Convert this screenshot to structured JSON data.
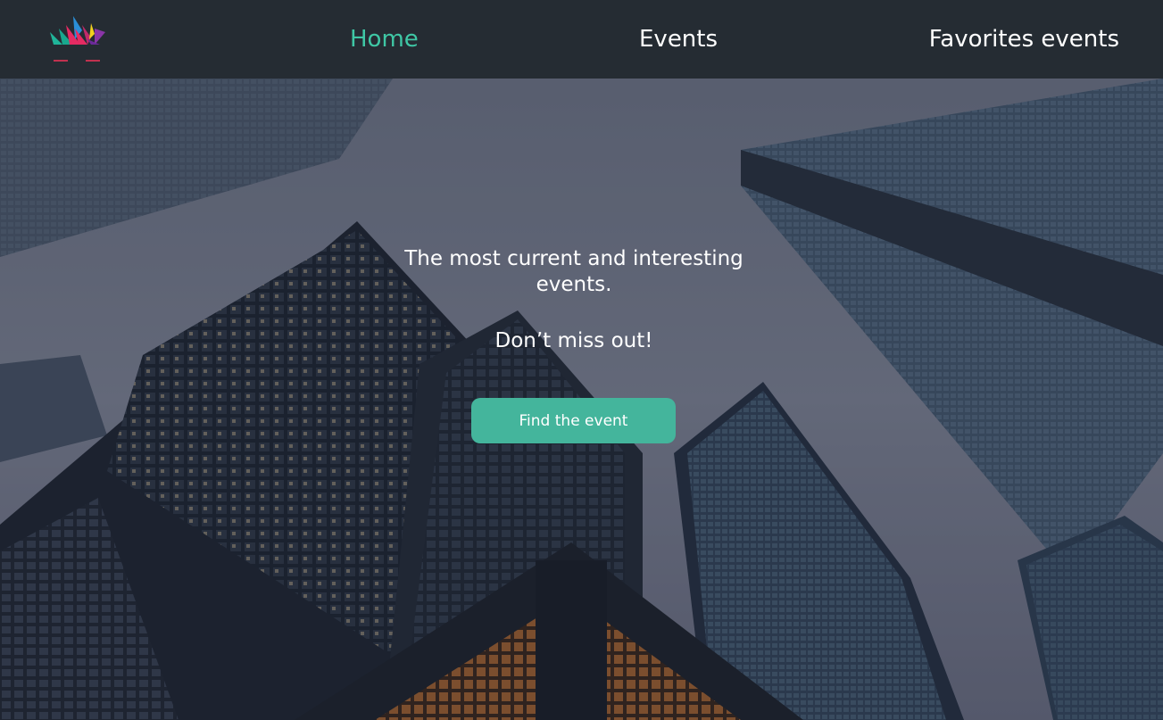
{
  "brand": {
    "logo_icon": "crown-logo-icon",
    "colors": [
      "#1fb59a",
      "#e52b63",
      "#2a8fd8",
      "#f3d11e",
      "#8a35a8"
    ]
  },
  "nav": {
    "items": [
      {
        "label": "Home",
        "active": true
      },
      {
        "label": "Events",
        "active": false
      },
      {
        "label": "Favorites events",
        "active": false
      }
    ],
    "active_color": "#3fc7a5"
  },
  "hero": {
    "headline": "The most current and interesting events.",
    "subline": "Don’t miss out!",
    "cta_label": "Find the event",
    "cta_color": "#44b59c",
    "background": "city-skyscrapers-photo"
  }
}
